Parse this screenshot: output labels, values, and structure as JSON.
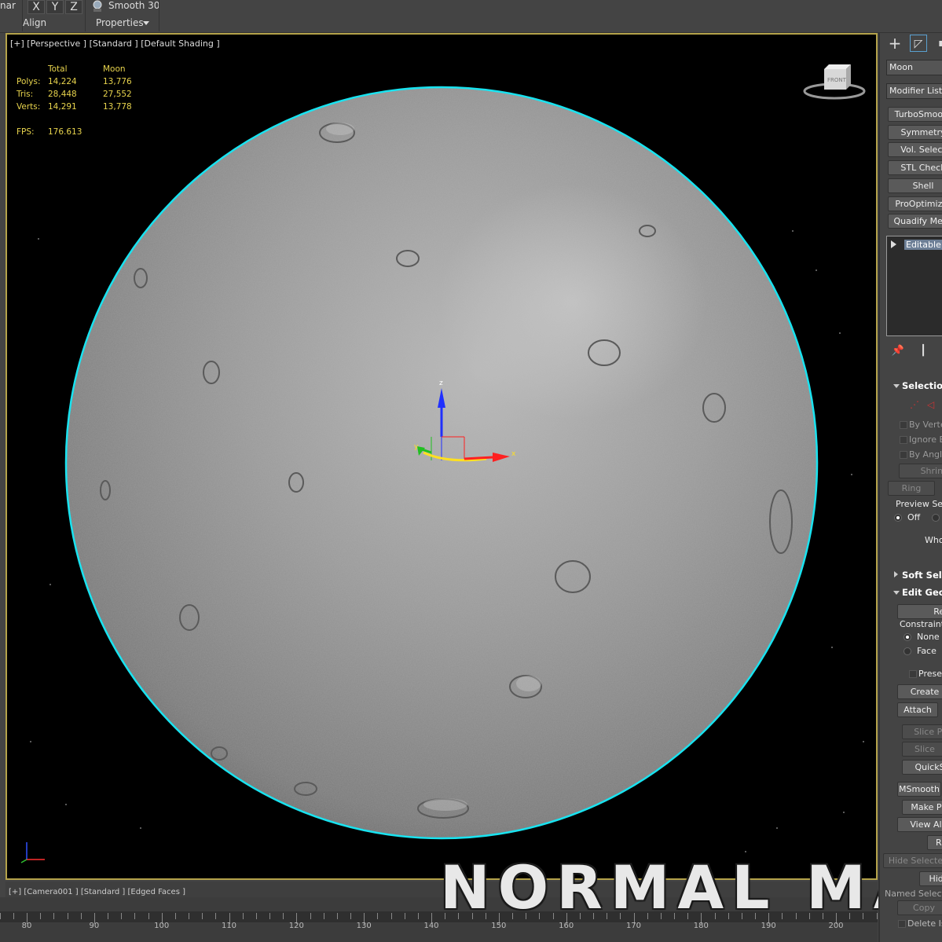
{
  "toolbar": {
    "left_fragment": "nar",
    "axis_buttons": [
      "X",
      "Y",
      "Z"
    ],
    "align_label": "Align",
    "smooth_label": "Smooth 30",
    "properties_label": "Properties"
  },
  "viewport": {
    "label": "[+] [Perspective ] [Standard ] [Default Shading ]",
    "stats": {
      "headers": [
        "Total",
        "Moon"
      ],
      "rows": [
        {
          "label": "Polys:",
          "total": "14,224",
          "moon": "13,776"
        },
        {
          "label": "Tris:",
          "total": "28,448",
          "moon": "27,552"
        },
        {
          "label": "Verts:",
          "total": "14,291",
          "moon": "13,778"
        }
      ],
      "fps_label": "FPS:",
      "fps_value": "176.613"
    },
    "viewcube_label": "FRONT",
    "gizmo_labels": {
      "x": "x",
      "y": "y",
      "z": "z"
    }
  },
  "viewport2": {
    "label": "[+] [Camera001 ] [Standard ] [Edged Faces ]"
  },
  "timeline": {
    "ticks": [
      80,
      90,
      100,
      110,
      120,
      130,
      140,
      150,
      160,
      170,
      180,
      190,
      200
    ]
  },
  "overlay_title": "NORMAL MAP",
  "command_panel": {
    "object_name": "Moon",
    "modifier_list": "Modifier List",
    "modifier_buttons": [
      "TurboSmooth",
      "Symmetry",
      "Vol. Select",
      "STL Check",
      "Shell",
      "ProOptimizer",
      "Quadify Mesh"
    ],
    "stack_item": "Editable Poly",
    "selection_rollout": "Selection",
    "selection_checks": [
      "By Vertex",
      "Ignore Backfacing",
      "By Angle"
    ],
    "shrink_label": "Shrink",
    "ring_label": "Ring",
    "preview_label": "Preview Selection",
    "preview_off": "Off",
    "whole_label": "Whole",
    "soft_selection": "Soft Selection",
    "edit_geometry": "Edit Geometry",
    "repeat_label": "Repeat",
    "constraints_label": "Constraints",
    "constraint_none": "None",
    "constraint_face": "Face",
    "preserve_label": "Preserve",
    "create_label": "Create",
    "attach_label": "Attach",
    "slice_plane_label": "Slice Plane",
    "slice_label": "Slice",
    "quickslice_label": "QuickSlice",
    "msmooth_label": "MSmooth",
    "make_planar_label": "Make Planar",
    "view_align_label": "View Align",
    "ra_label": "Ra",
    "hide_selected_label": "Hide Selected",
    "hide_label": "Hide",
    "named_selections_label": "Named Selections",
    "copy_label": "Copy",
    "delete_isolated_label": "Delete Isolated"
  },
  "colors": {
    "viewport_border": "#b4a24a",
    "selection_outline": "#19e3f0",
    "stats_text": "#e8d44d",
    "stack_highlight": "#6d7f96"
  }
}
